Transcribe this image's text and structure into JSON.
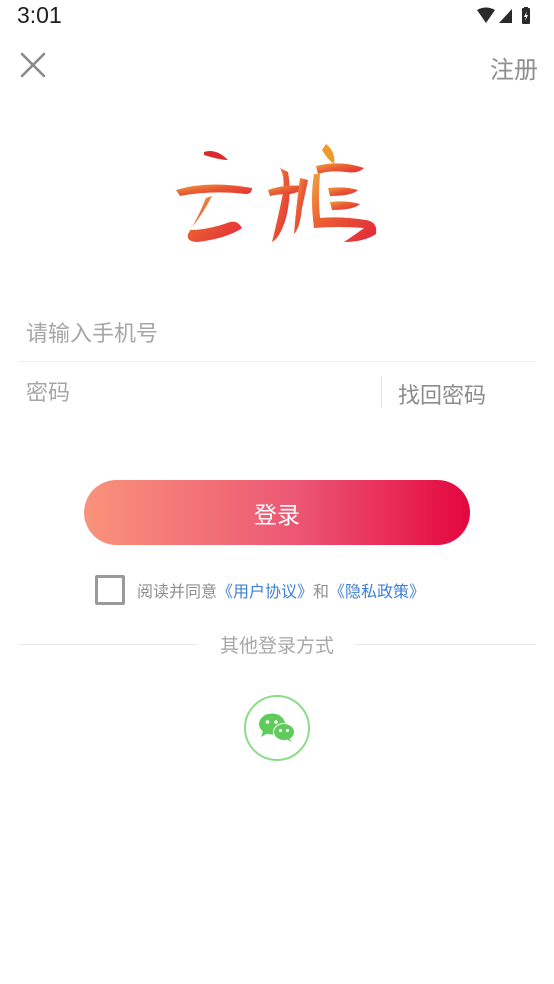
{
  "status_bar": {
    "time": "3:01",
    "icons": [
      "wifi-icon",
      "signal-icon",
      "battery-icon"
    ]
  },
  "top_bar": {
    "close_icon": "close-icon",
    "register_label": "注册"
  },
  "logo": {
    "text": "云鹤"
  },
  "form": {
    "phone_placeholder": "请输入手机号",
    "phone_value": "",
    "password_placeholder": "密码",
    "password_value": "",
    "forgot_label": "找回密码"
  },
  "login_button": {
    "label": "登录"
  },
  "agreement": {
    "checked": false,
    "prefix": "阅读并同意",
    "user_agreement": "《用户协议》",
    "conjunction": "和",
    "privacy_policy": "《隐私政策》"
  },
  "other_login": {
    "label": "其他登录方式",
    "methods": [
      "wechat-icon"
    ]
  },
  "colors": {
    "gradient_start": "#f9937b",
    "gradient_end": "#e3073f",
    "link_blue": "#3d7fd4",
    "wechat_green": "#5fcb5a"
  }
}
